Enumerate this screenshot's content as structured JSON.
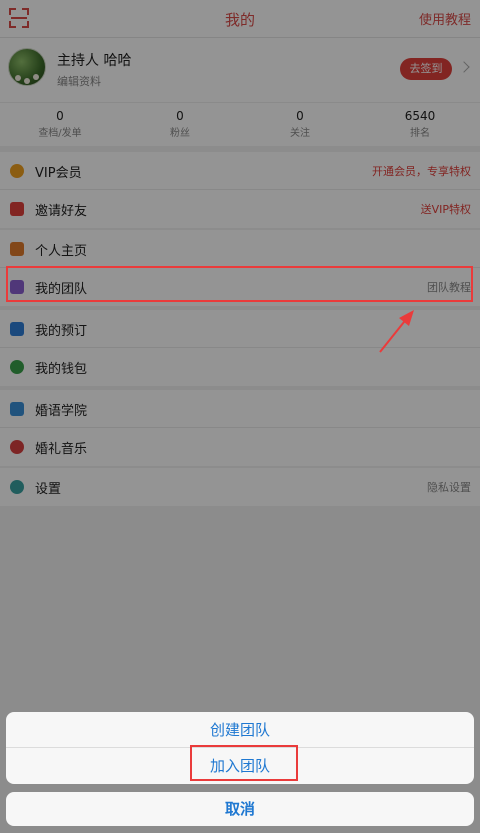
{
  "header": {
    "title": "我的",
    "tutorial": "使用教程"
  },
  "profile": {
    "name": "主持人 哈哈",
    "edit": "编辑资料",
    "checkin": "去签到"
  },
  "stats": [
    {
      "value": "0",
      "label": "查档/发单"
    },
    {
      "value": "0",
      "label": "粉丝"
    },
    {
      "value": "0",
      "label": "关注"
    },
    {
      "value": "6540",
      "label": "排名"
    }
  ],
  "menu": {
    "vip": {
      "label": "VIP会员",
      "right": "开通会员，专享特权"
    },
    "invite": {
      "label": "邀请好友",
      "right": "送VIP特权"
    },
    "homepage": {
      "label": "个人主页"
    },
    "team": {
      "label": "我的团队",
      "right": "团队教程"
    },
    "booking": {
      "label": "我的预订"
    },
    "wallet": {
      "label": "我的钱包"
    },
    "academy": {
      "label": "婚语学院"
    },
    "music": {
      "label": "婚礼音乐"
    },
    "settings": {
      "label": "设置",
      "right": "隐私设置"
    }
  },
  "sheet": {
    "create": "创建团队",
    "join": "加入团队",
    "cancel": "取消"
  },
  "colors": {
    "accent": "#e0403c",
    "sheet_text": "#1f78d1",
    "highlight": "#ea3b3b"
  }
}
